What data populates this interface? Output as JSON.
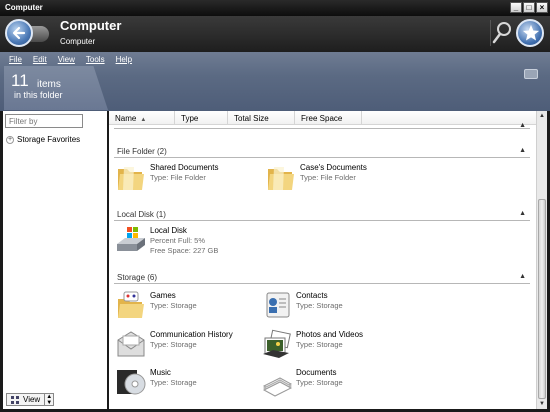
{
  "window": {
    "title": "Computer"
  },
  "header": {
    "title": "Computer",
    "subtitle": "Computer"
  },
  "menu": [
    "File",
    "Edit",
    "View",
    "Tools",
    "Help"
  ],
  "info": {
    "count": "11",
    "count_word": "items",
    "count_sub": "in this folder"
  },
  "sidebar": {
    "filter_placeholder": "Filter by",
    "favorites": "Storage Favorites",
    "view_label": "View"
  },
  "columns": [
    "Name",
    "Type",
    "Total Size",
    "Free Space"
  ],
  "groups": [
    {
      "label": "File Folder (2)"
    },
    {
      "label": "Local Disk (1)"
    },
    {
      "label": "Storage (6)"
    }
  ],
  "items": {
    "shared": {
      "name": "Shared Documents",
      "type": "Type: File Folder"
    },
    "cases": {
      "name": "Case's Documents",
      "type": "Type: File Folder"
    },
    "disk": {
      "name": "Local Disk",
      "percent": "Percent Full: 5%",
      "free": "Free Space: 227 GB"
    },
    "games": {
      "name": "Games",
      "type": "Type: Storage"
    },
    "contacts": {
      "name": "Contacts",
      "type": "Type: Storage"
    },
    "comms": {
      "name": "Communication History",
      "type": "Type: Storage"
    },
    "photos": {
      "name": "Photos and Videos",
      "type": "Type: Storage"
    },
    "music": {
      "name": "Music",
      "type": "Type: Storage"
    },
    "documents": {
      "name": "Documents",
      "type": "Type: Storage"
    }
  },
  "colors": {
    "band": "#5b6a83",
    "header": "#2b2b2b",
    "accent": "#4a78b5"
  }
}
